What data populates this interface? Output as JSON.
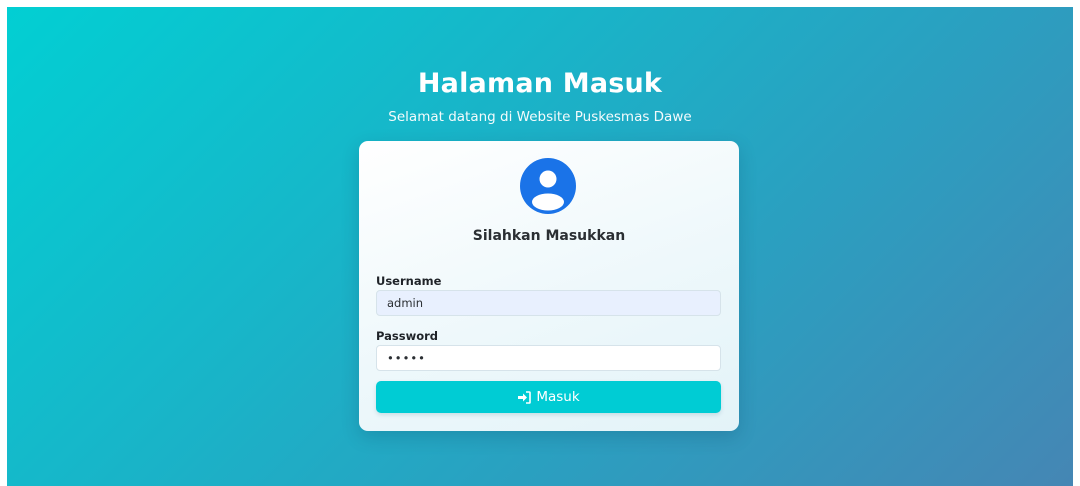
{
  "header": {
    "title": "Halaman Masuk",
    "subtitle": "Selamat datang di Website Puskesmas Dawe"
  },
  "card": {
    "avatar_icon": "user-circle-icon",
    "heading": "Silahkan Masukkan",
    "username": {
      "label": "Username",
      "value": "admin"
    },
    "password": {
      "label": "Password",
      "value": "admin"
    },
    "submit": {
      "icon": "sign-in-icon",
      "label": "Masuk"
    }
  },
  "colors": {
    "gradient_start": "#02cfd3",
    "gradient_end": "#4586b4",
    "avatar": "#1a73e8",
    "button": "#00ccd4",
    "username_field_bg": "#e8f0fe"
  }
}
